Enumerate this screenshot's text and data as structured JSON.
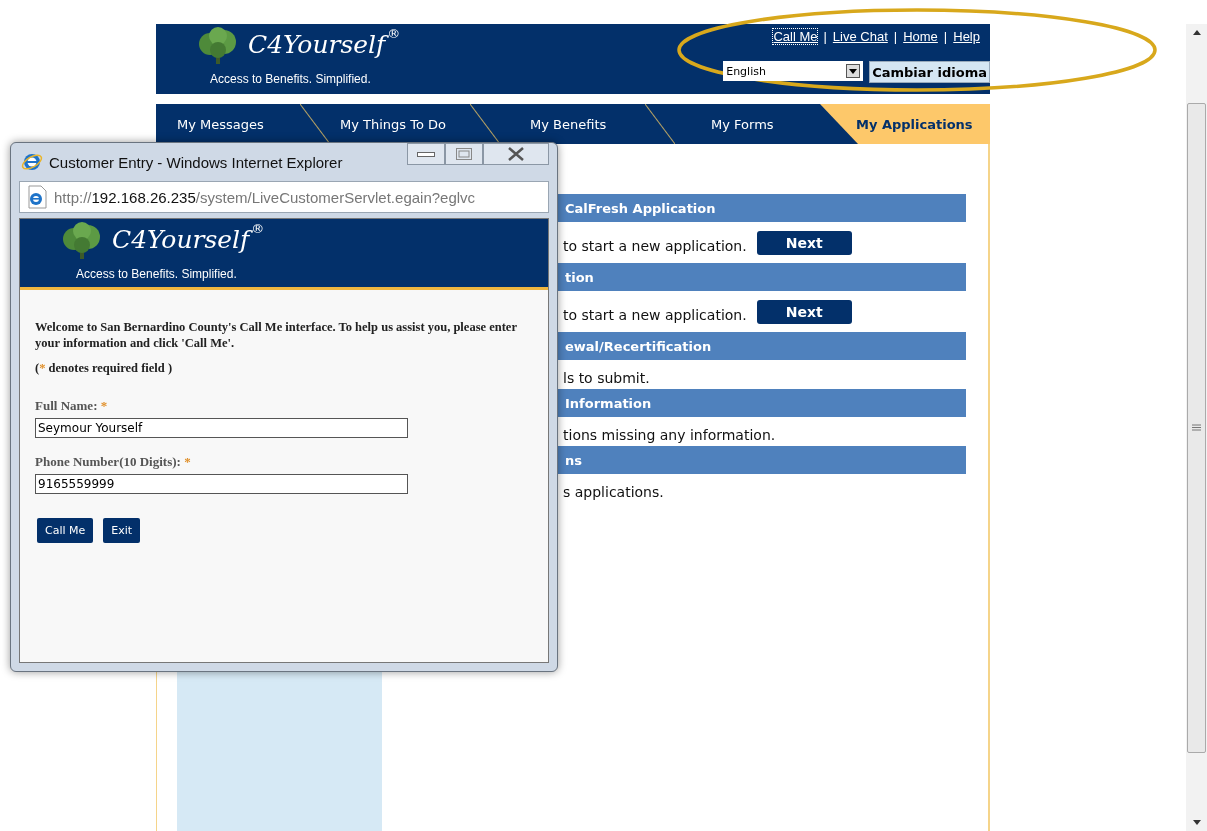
{
  "site": {
    "logo": "C4Yourself",
    "registered": "®",
    "tagline": "Access to Benefits.  Simplified.",
    "top_links": [
      {
        "label": "Call Me",
        "focused": true
      },
      {
        "label": "Live Chat",
        "focused": false
      },
      {
        "label": "Home",
        "focused": false
      },
      {
        "label": "Help",
        "focused": false
      }
    ],
    "separators": [
      "|",
      "|",
      "|"
    ],
    "language": {
      "value": "English"
    },
    "language_button": "Cambiar idioma"
  },
  "tabs": [
    {
      "label": "My Messages",
      "selected": false
    },
    {
      "label": "My Things To Do",
      "selected": false
    },
    {
      "label": "My Benefits",
      "selected": false
    },
    {
      "label": "My Forms",
      "selected": false
    },
    {
      "label": "My Applications",
      "selected": true
    }
  ],
  "sections": [
    {
      "title": "CalFresh Application",
      "text": "to start a new application.",
      "button": "Next"
    },
    {
      "title": "tion",
      "text": "to start a new application.",
      "button": "Next"
    },
    {
      "title": "ewal/Recertification",
      "text": "ls to submit."
    },
    {
      "title": "Information",
      "text": "tions missing any information."
    },
    {
      "title": "ns",
      "text": "s applications."
    }
  ],
  "popup": {
    "title": "Customer Entry - Windows Internet Explorer",
    "address": {
      "scheme": "http://",
      "host": "192.168.26.235",
      "path": "/system/LiveCustomerServlet.egain?eglvc"
    },
    "logo": "C4Yourself",
    "registered": "®",
    "tagline": "Access to Benefits.  Simplified.",
    "intro": "Welcome to San Bernardino County's Call Me interface. To help us assist you, please enter your information and click 'Call Me'.",
    "note": {
      "open": "(",
      "mark": "*",
      "text": " denotes required field )"
    },
    "fields": [
      {
        "label": "Full Name:",
        "required_mark": "*",
        "value": "Seymour Yourself"
      },
      {
        "label": "Phone Number(10 Digits):",
        "required_mark": "*",
        "value": "9165559999"
      }
    ],
    "buttons": [
      "Call Me",
      "Exit"
    ]
  }
}
